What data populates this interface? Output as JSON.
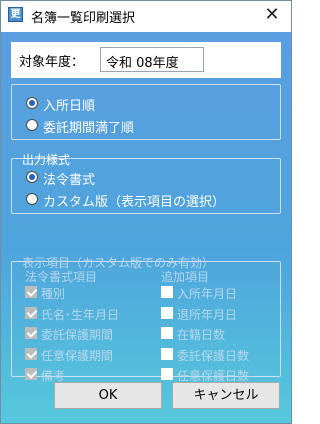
{
  "window": {
    "title": "名簿一覧印刷選択",
    "app_icon_glyph": "更",
    "close_glyph": "✕"
  },
  "year": {
    "label": "対象年度：",
    "value": "令和 08年度"
  },
  "sort": {
    "options": [
      {
        "label": "入所日順",
        "checked": true
      },
      {
        "label": "委託期間満了順",
        "checked": false
      }
    ]
  },
  "output": {
    "legend": "出力様式",
    "options": [
      {
        "label": "法令書式",
        "checked": true
      },
      {
        "label": "カスタム版（表示項目の選択）",
        "checked": false
      }
    ]
  },
  "display_items": {
    "legend": "表示項目（カスタム版でのみ有効）",
    "left_header": "法令書式項目",
    "right_header": "追加項目",
    "left_items": [
      {
        "label": "種別",
        "checked": true
      },
      {
        "label": "氏名･生年月日",
        "checked": true
      },
      {
        "label": "委託保護期間",
        "checked": true
      },
      {
        "label": "任意保護期間",
        "checked": true
      },
      {
        "label": "備考",
        "checked": true
      }
    ],
    "right_items": [
      {
        "label": "入所年月日",
        "checked": false
      },
      {
        "label": "退所年月日",
        "checked": false
      },
      {
        "label": "在籍日数",
        "checked": false
      },
      {
        "label": "委託保護日数",
        "checked": false
      },
      {
        "label": "任意保護日数",
        "checked": false
      }
    ]
  },
  "buttons": {
    "ok": "OK",
    "cancel": "キャンセル"
  }
}
